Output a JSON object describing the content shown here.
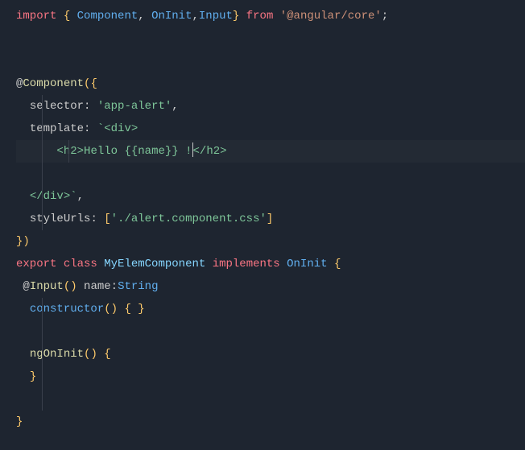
{
  "code": {
    "l1": {
      "import": "import",
      "lb": "{",
      "Component": "Component",
      "c1": ",",
      "OnInit": "OnInit",
      "c2": ",",
      "Input": "Input",
      "rb": "}",
      "from": "from",
      "str": "'@angular/core'",
      "semi": ";"
    },
    "l4": {
      "at": "@",
      "dec": "Component",
      "lp": "(",
      "lb": "{"
    },
    "l5": {
      "key": "selector",
      "colon": ":",
      "val": "'app-alert'",
      "comma": ","
    },
    "l6": {
      "key": "template",
      "colon": ":",
      "tick": "`",
      "open_div": "<div>"
    },
    "l7": {
      "indent": "      ",
      "open_h2a": "<",
      "open_h2b": "h2",
      "open_h2c": ">",
      "hello": "Hello ",
      "interp_l": "{{",
      "interp_name": "name",
      "interp_r": "}}",
      "bang": " !",
      "close_h2a": "<",
      "close_h2s": "/",
      "close_h2b": "h2",
      "close_h2c": ">"
    },
    "l9": {
      "close_div": "</div>",
      "tick": "`",
      "comma": ","
    },
    "l10": {
      "key": "styleUrls",
      "colon": ":",
      "lb": "[",
      "val": "'./alert.component.css'",
      "rb": "]"
    },
    "l11": {
      "rb": "}",
      "rp": ")"
    },
    "l12": {
      "export": "export",
      "class": "class",
      "name": "MyElemComponent",
      "implements": "implements",
      "OnInit": "OnInit",
      "lb": "{"
    },
    "l13": {
      "at": "@",
      "dec": "Input",
      "lp": "(",
      "rp": ")",
      "name": "name",
      "colon": ":",
      "type": "String"
    },
    "l14": {
      "ctor": "constructor",
      "lp": "(",
      "rp": ")",
      "lb": "{",
      "rb": "}"
    },
    "l16": {
      "m": "ngOnInit",
      "lp": "(",
      "rp": ")",
      "lb": "{"
    },
    "l17": {
      "rb": "}"
    },
    "l19": {
      "rb": "}"
    }
  }
}
